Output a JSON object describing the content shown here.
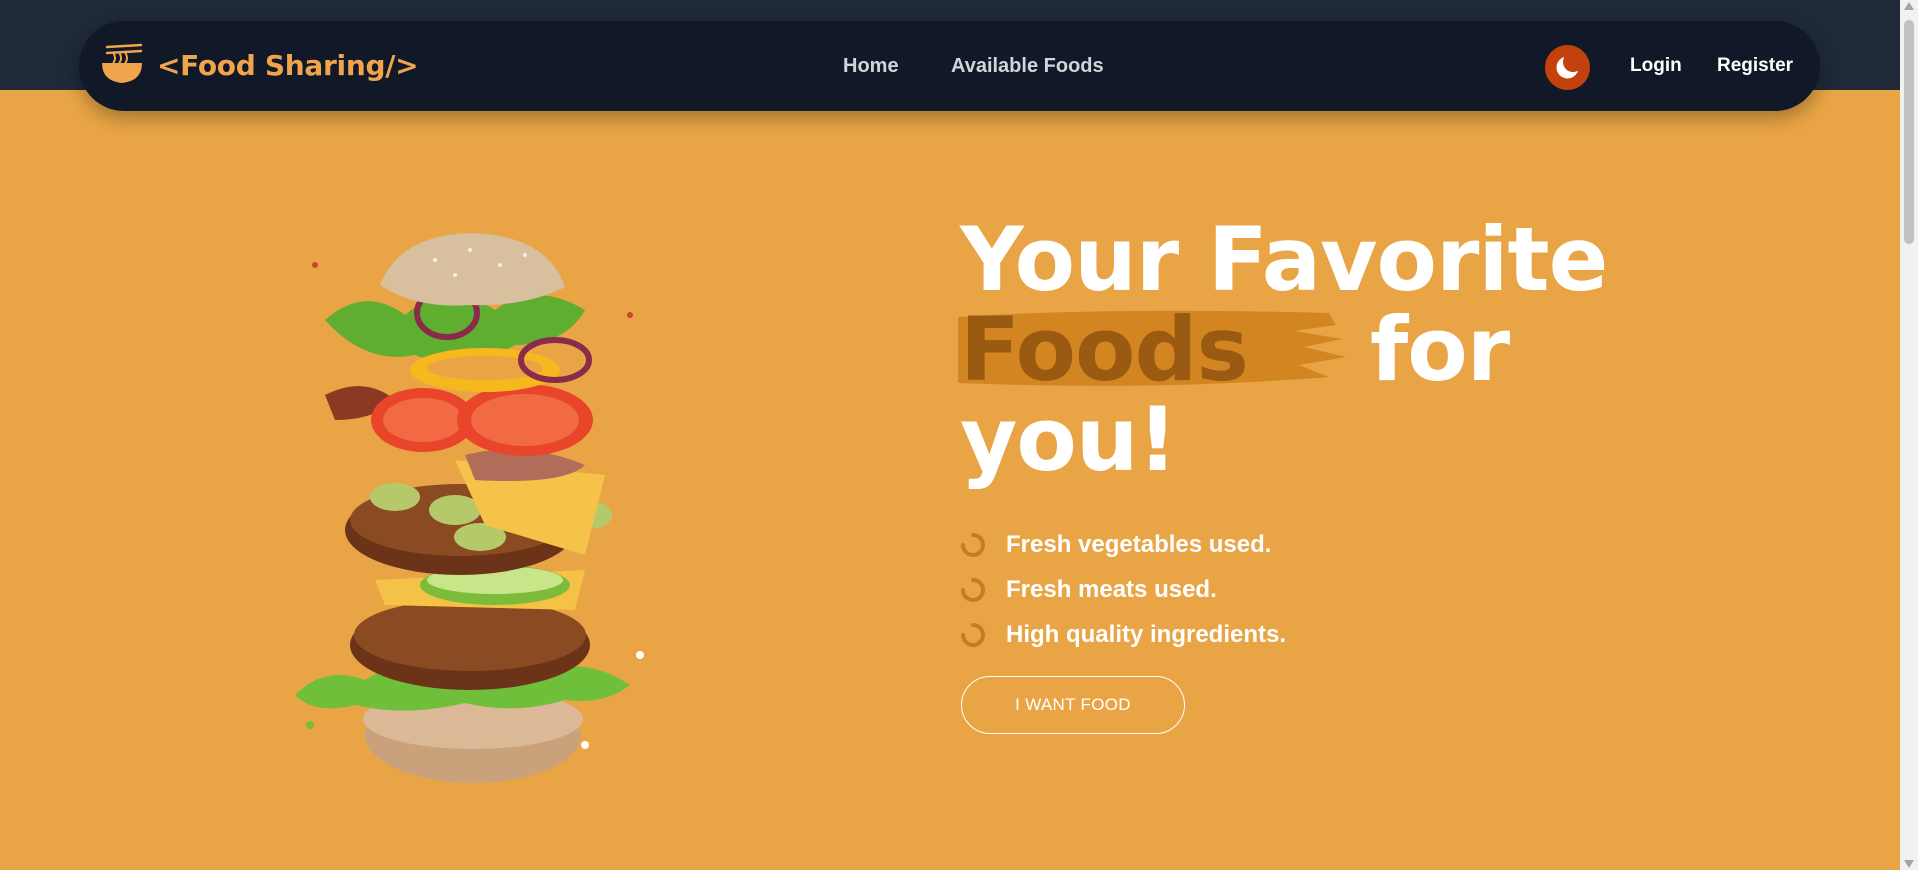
{
  "navbar": {
    "logo_text": "<Food Sharing/>",
    "logo_icon": "noodle-bowl-icon",
    "links": [
      {
        "label": "Home"
      },
      {
        "label": "Available Foods"
      }
    ],
    "theme_toggle_icon": "moon-icon",
    "login_label": "Login",
    "register_label": "Register"
  },
  "hero": {
    "title_line1": "Your Favorite",
    "title_highlight": "Foods",
    "title_line2_end": "for",
    "title_line3": "you!",
    "features": [
      {
        "text": "Fresh vegetables used.",
        "icon": "spinner-icon"
      },
      {
        "text": "Fresh meats used.",
        "icon": "spinner-icon"
      },
      {
        "text": "High quality ingredients.",
        "icon": "spinner-icon"
      }
    ],
    "cta_label": "I WANT FOOD",
    "image": "burger-illustration"
  },
  "colors": {
    "page_background": "#e9a545",
    "navbar_background": "#111827",
    "brand_orange": "#f0a44c",
    "toggle_background": "#c2410c",
    "highlight_text": "#9a5a12"
  }
}
